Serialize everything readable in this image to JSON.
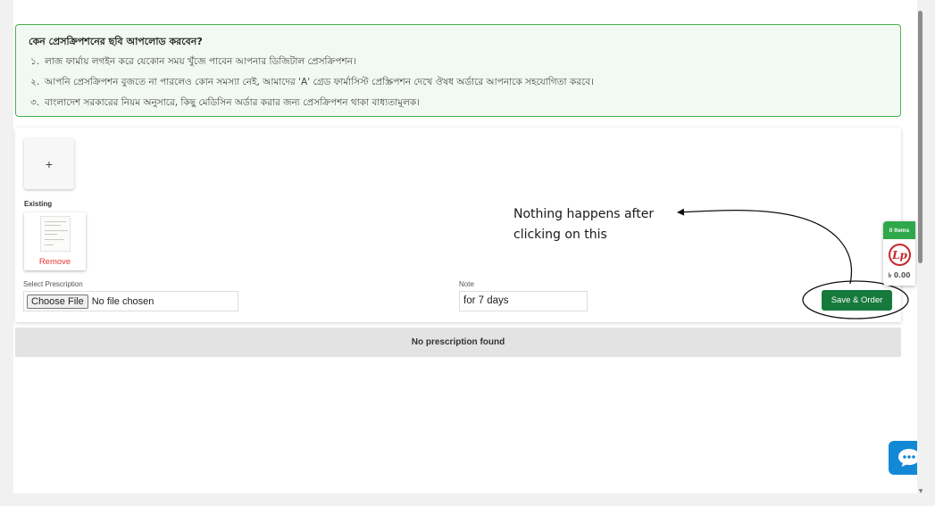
{
  "info": {
    "title": "কেন প্রেসক্রিপশনের ছবি আপলোড করবেন?",
    "lines": [
      {
        "num": "১.",
        "text": "লাজ ফার্মায় লগইন করে যেকোন সময় খুঁজে পাবেন আপনার ডিজিটাল প্রেসক্রিপশন।"
      },
      {
        "num": "২.",
        "text": "আপনি প্রেসক্রিপশন বুজতে না পারলেও কোন সমস্যা নেই, আমাদের 'A' গ্রেড ফার্মাসিস্ট প্রেস্ক্রিপশন দেখে ঔষধ অর্ডারে আপনাকে সহযোগিতা করবে।"
      },
      {
        "num": "৩.",
        "text": "বাংলাদেশ সরকারের নিয়ম অনুসারে, কিছু মেডিসিন অর্ডার করার জন্য প্রেসক্রিপশন থাকা বাধ্যতামূলক।"
      }
    ]
  },
  "upload": {
    "add_symbol": "+",
    "existing_label": "Existing",
    "remove_label": "Remove",
    "select_label": "Select Prescription",
    "choose_file_label": "Choose File",
    "no_file_text": "No file chosen",
    "note_label": "Note",
    "note_value": "for 7 days",
    "save_label": "Save & Order"
  },
  "list": {
    "empty_text": "No prescription found"
  },
  "annotation": {
    "text": "Nothing happens after clicking on this"
  },
  "cart": {
    "items_label": "0 Items",
    "logo_text": "Lp",
    "price": "৳ 0.00"
  },
  "icons": {
    "chat": "chat-bubble-icon",
    "cart_logo": "lazz-pharma-logo-icon",
    "thumbnail": "prescription-image-icon"
  },
  "colors": {
    "accent_green": "#157a3c",
    "info_border": "#4caf50",
    "remove_red": "#e53935",
    "chat_blue": "#1389d6"
  }
}
